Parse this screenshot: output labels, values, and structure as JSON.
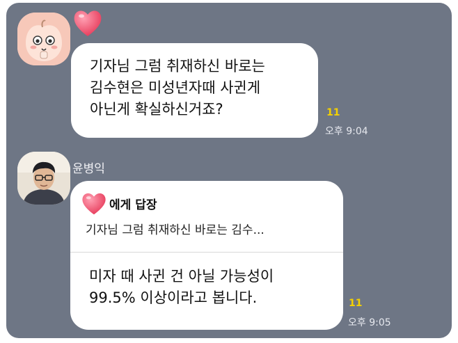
{
  "messages": [
    {
      "text": "기자님 그럼 취재하신 바로는\n김수현은 미성년자때 사귄게\n아닌게 확실하신거죠?",
      "unread_count": "11",
      "time": "오후 9:04"
    },
    {
      "sender": "윤병익",
      "reply_title": "에게 답장",
      "reply_quote": "기자님 그럼 취재하신 바로는 김수...",
      "text": "미자 때 사귄 건 아닐 가능성이\n99.5% 이상이라고 봅니다.",
      "unread_count": "11",
      "time": "오후 9:05"
    }
  ],
  "colors": {
    "chat_background": "#6e7685",
    "bubble": "#ffffff",
    "unread": "#f5d100",
    "heart": "#f05a78"
  },
  "icons": {
    "avatar_1": "peach-character-avatar",
    "avatar_2": "person-photo-avatar",
    "sticker": "heart-icon"
  }
}
